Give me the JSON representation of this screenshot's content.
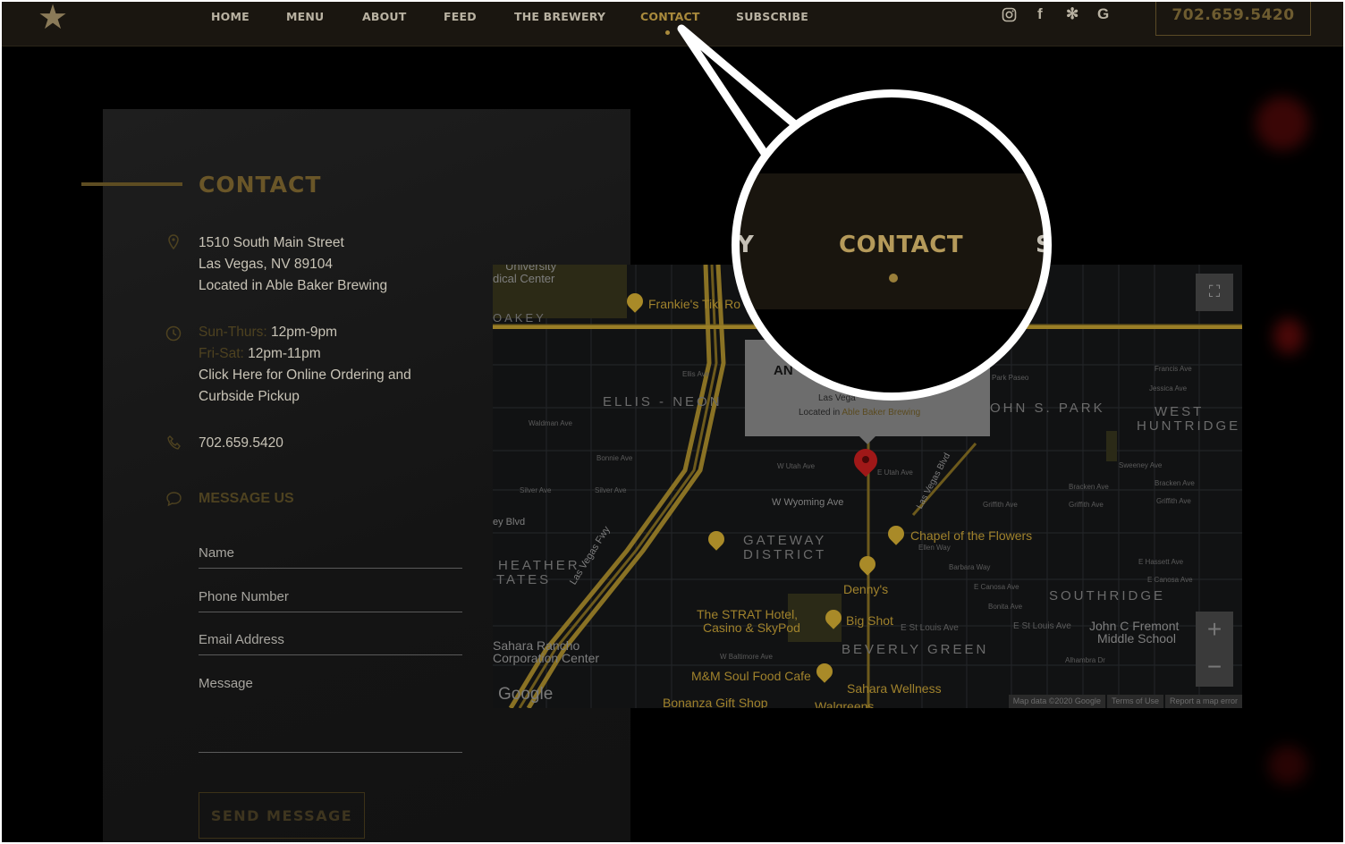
{
  "nav": {
    "items": [
      "HOME",
      "MENU",
      "ABOUT",
      "FEED",
      "THE BREWERY",
      "CONTACT",
      "SUBSCRIBE"
    ],
    "active": "CONTACT",
    "phone": "702.659.5420",
    "social_icons": [
      "instagram-icon",
      "facebook-icon",
      "yelp-icon",
      "google-icon"
    ]
  },
  "contact": {
    "title": "CONTACT",
    "address_line1": "1510 South Main Street",
    "address_line2": "Las Vegas, NV 89104",
    "address_line3": "Located in Able Baker Brewing",
    "hours1_label": "Sun-Thurs:",
    "hours1_value": " 12pm-9pm",
    "hours2_label": "Fri-Sat:",
    "hours2_value": " 12pm-11pm",
    "ordering_line1": "Click Here for Online Ordering and",
    "ordering_line2": "Curbside Pickup",
    "phone": "702.659.5420",
    "message_title": "MESSAGE US",
    "fields": {
      "name": "Name",
      "phone": "Phone Number",
      "email": "Email Address",
      "message": "Message"
    },
    "send_label": "SEND MESSAGE"
  },
  "map": {
    "infowindow_title": "AN",
    "infowindow_address": "Las Vega",
    "infowindow_located": "Located in ",
    "infowindow_place": "Able Baker Brewing",
    "labels": {
      "frankies": "Frankie's Tiki Ro",
      "univ": "University",
      "medical": "dical Center",
      "oakey": "OAKEY",
      "ellis": "ELLIS - NEON",
      "johns": "OHN S. PARK",
      "west": "WEST",
      "huntridge": "HUNTRIDGE",
      "gateway": "GATEWAY",
      "district": "DISTRICT",
      "heather": "HEATHER",
      "tates": "TATES",
      "chapel": "Chapel of the Flowers",
      "dennys": "Denny's",
      "southridge": "SOUTHRIDGE",
      "strat1": "The STRAT Hotel,",
      "strat2": "Casino & SkyPod",
      "bigshot": "Big Shot",
      "fremont1": "John C Fremont",
      "fremont2": "Middle School",
      "beverly": "BEVERLY GREEN",
      "sahara1": "Sahara Rancho",
      "sahara2": "Corporation Center",
      "mm": "M&M Soul Food Cafe",
      "saharaw": "Sahara Wellness",
      "bonanza": "Bonanza Gift Shop",
      "walgreens": "Walgreens",
      "ey_blvd": "ey Blvd",
      "wyoming": "W Wyoming Ave",
      "utah": "W Utah Ave",
      "e_utah": "E Utah Ave",
      "waldman": "Waldman Ave",
      "ellis_ave": "Ellis Ave",
      "silver": "Silver Ave",
      "silver2": "Silver Ave",
      "bonnie": "Bonnie Ave",
      "park_paseo": "Park Paseo",
      "francis": "Francis Ave",
      "jessica": "Jessica Ave",
      "sweeney": "Sweeney Ave",
      "bracken": "Bracken Ave",
      "bracken2": "Bracken Ave",
      "griffith": "Griffith Ave",
      "griffith2": "Griffith Ave",
      "griffith3": "Griffith Ave",
      "ellen": "Ellen Way",
      "barbara": "Barbara Way",
      "ecanosa": "E Canosa Ave",
      "ecanosa2": "E Canosa Ave",
      "ehassett": "E Hassett Ave",
      "bonita": "Bonita Ave",
      "stlouis": "E St Louis Ave",
      "stlouis2": "E St Louis Ave",
      "baltimore": "W Baltimore Ave",
      "alhambra": "Alhambra Dr",
      "lvfwy": "Las Vegas Fwy",
      "lvblvd": "Las Vegas Blvd",
      "google": "Google",
      "footer_data": "Map data ©2020 Google",
      "footer_terms": "Terms of Use",
      "footer_report": "Report a map error"
    },
    "zoom_in": "+",
    "zoom_out": "−",
    "fullscreen": "⛶"
  },
  "magnifier": {
    "text": "CONTACT",
    "left_char": "Y",
    "right_char": "S"
  }
}
